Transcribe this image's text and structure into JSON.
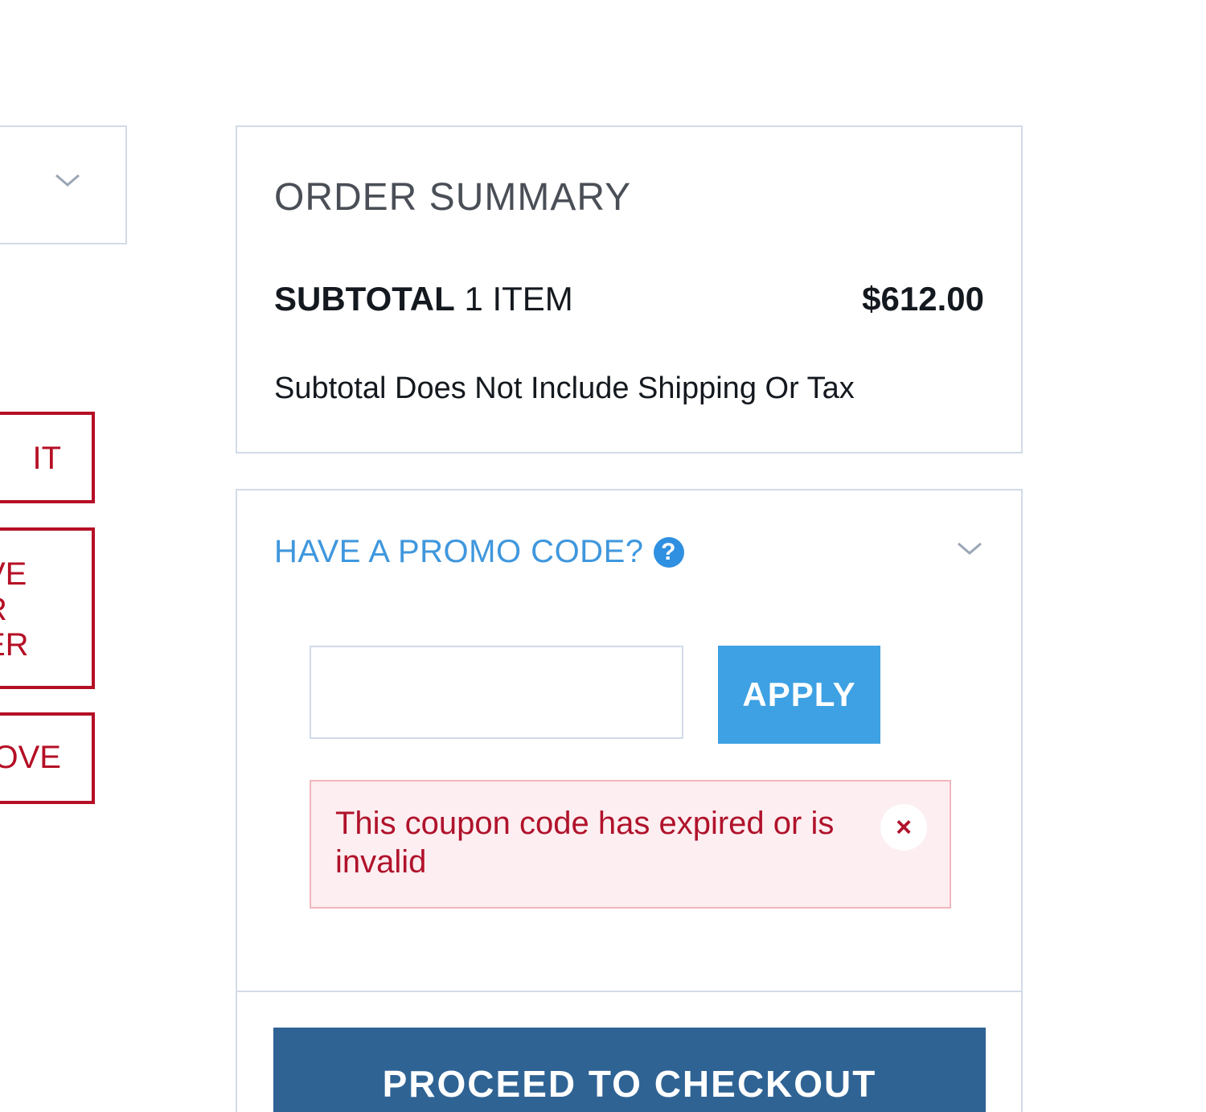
{
  "left_column": {
    "buttons": [
      {
        "label": "IT"
      },
      {
        "label": "VE\nR\nER"
      },
      {
        "label": "OVE"
      }
    ]
  },
  "order_summary": {
    "title": "ORDER SUMMARY",
    "subtotal_label": "SUBTOTAL",
    "item_count": "1 ITEM",
    "subtotal_amount": "$612.00",
    "note": "Subtotal Does Not Include Shipping Or Tax"
  },
  "promo": {
    "header": "HAVE A PROMO CODE?",
    "help_glyph": "?",
    "input_value": "",
    "apply_label": "APPLY",
    "error_message": "This coupon code has expired or is invalid",
    "close_glyph": "×"
  },
  "checkout": {
    "label": "PROCEED TO CHECKOUT"
  },
  "colors": {
    "accent_blue": "#3ea1e3",
    "checkout_blue": "#2f6394",
    "error_red": "#b0122b",
    "error_bg": "#fdeef1",
    "left_button_red": "#b50f25"
  }
}
